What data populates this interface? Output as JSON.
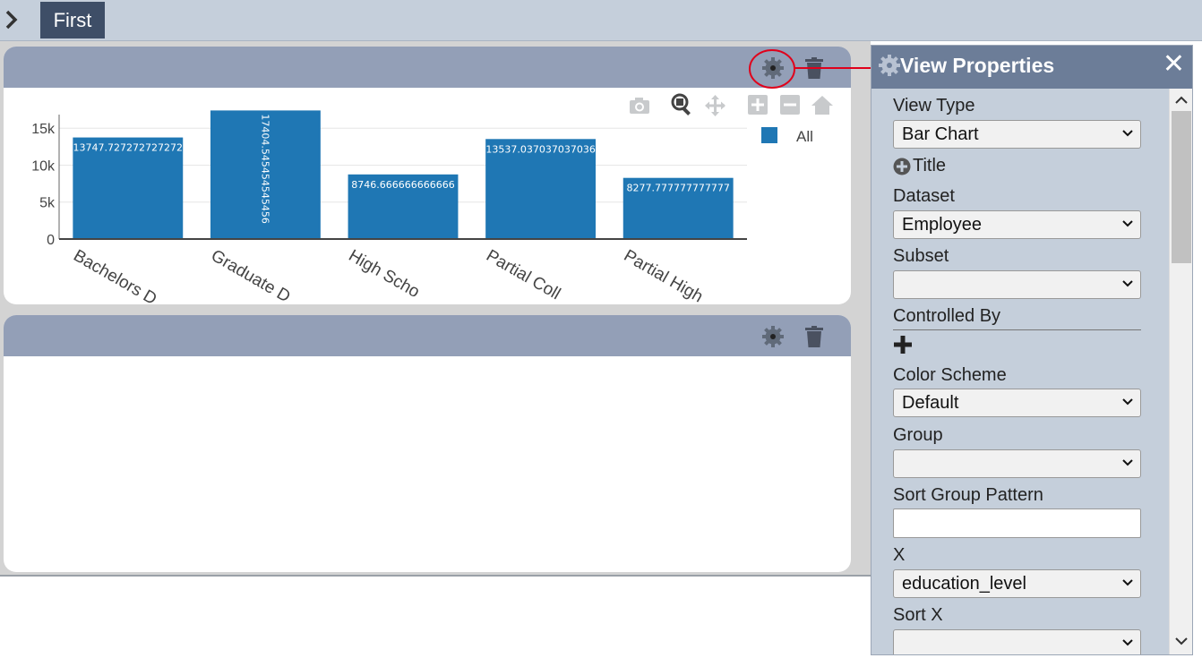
{
  "tabs": [
    {
      "label": "First"
    }
  ],
  "panel1": {
    "chart_data": {
      "type": "bar",
      "categories": [
        "Bachelors D",
        "Graduate D",
        "High Scho",
        "Partial Coll",
        "Partial High"
      ],
      "series": [
        {
          "name": "All",
          "values": [
            13747.727272727272,
            17404.545454545456,
            8746.666666666666,
            13537.037037037036,
            8277.777777777777
          ]
        }
      ],
      "data_labels": [
        "13747.727272727272",
        "17404.545454545456",
        "8746.666666666666",
        "13537.037037037036",
        "8277.777777777777"
      ],
      "yticks": [
        {
          "v": 0,
          "label": "0"
        },
        {
          "v": 5000,
          "label": "5k"
        },
        {
          "v": 10000,
          "label": "10k"
        },
        {
          "v": 15000,
          "label": "15k"
        }
      ],
      "ylim": [
        0,
        18300
      ],
      "legend_position": "top-right",
      "grid": true,
      "color": "#1f77b4"
    }
  },
  "properties": {
    "title": "View Properties",
    "close_label": "✕",
    "fields": {
      "view_type": {
        "label": "View Type",
        "value": "Bar Chart"
      },
      "title_add": {
        "label": "Title"
      },
      "dataset": {
        "label": "Dataset",
        "value": "Employee"
      },
      "subset": {
        "label": "Subset",
        "value": ""
      },
      "controlled_by": {
        "label": "Controlled By"
      },
      "color_scheme": {
        "label": "Color Scheme",
        "value": "Default"
      },
      "group": {
        "label": "Group",
        "value": ""
      },
      "sort_group_pattern": {
        "label": "Sort Group Pattern",
        "value": ""
      },
      "x": {
        "label": "X",
        "value": "education_level"
      },
      "sort_x": {
        "label": "Sort X",
        "value": ""
      }
    }
  },
  "colors": {
    "accent_dark": "#3e4e67",
    "panel_header": "#939fb7",
    "bar": "#1f77b4",
    "highlight_ring": "#e0001b"
  }
}
